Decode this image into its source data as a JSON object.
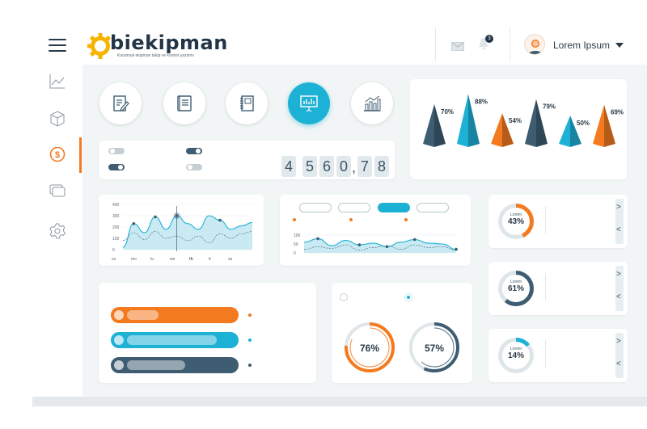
{
  "app": {
    "logo_text": "biekipman",
    "logo_subtitle": "Kurumsal ekipman takip ve kontrol yazılımı"
  },
  "header": {
    "notification_count": "3",
    "user_name": "Lorem Ipsum",
    "icons": [
      "menu-icon",
      "mail-icon",
      "bell-icon",
      "avatar-icon",
      "caret-down-icon"
    ]
  },
  "sidebar": {
    "items": [
      {
        "icon": "line-chart-icon",
        "active": false
      },
      {
        "icon": "cube-icon",
        "active": false
      },
      {
        "icon": "dollar-icon",
        "active": true
      },
      {
        "icon": "cards-icon",
        "active": false
      },
      {
        "icon": "settings-icon",
        "active": false
      }
    ]
  },
  "quick_actions": [
    {
      "icon": "edit-document-icon",
      "active": false
    },
    {
      "icon": "book-icon",
      "active": false
    },
    {
      "icon": "notebook-icon",
      "active": false
    },
    {
      "icon": "presentation-board-icon",
      "active": true
    },
    {
      "icon": "bar-chart-icon",
      "active": false
    }
  ],
  "counter": {
    "digits": [
      "4",
      "5",
      "6",
      "0",
      "7",
      "8"
    ],
    "separator": ",",
    "toggles": [
      {
        "on": false
      },
      {
        "on": true
      },
      {
        "on": true
      },
      {
        "on": false
      }
    ]
  },
  "pyramids": {
    "items": [
      {
        "label": "70%",
        "color": "#3f5d72",
        "value": 70
      },
      {
        "label": "88%",
        "color": "#1eb1d6",
        "value": 88
      },
      {
        "label": "54%",
        "color": "#f47a20",
        "value": 54
      },
      {
        "label": "79%",
        "color": "#3f5d72",
        "value": 79
      },
      {
        "label": "50%",
        "color": "#1eb1d6",
        "value": 50
      },
      {
        "label": "69%",
        "color": "#f47a20",
        "value": 69
      }
    ]
  },
  "chart_data": [
    {
      "type": "area",
      "categories": [
        "su",
        "mo",
        "tu",
        "we",
        "th",
        "fr",
        "sa"
      ],
      "highlight_category": "th",
      "ylim": [
        0,
        400
      ],
      "yticks": [
        "400",
        "300",
        "200",
        "100",
        "0"
      ],
      "series": [
        {
          "values": [
            20,
            230,
            150,
            290,
            180,
            300,
            230,
            180,
            300,
            260,
            180,
            210,
            240
          ],
          "color": "#1eb1d6"
        },
        {
          "values": [
            80,
            150,
            90,
            160,
            100,
            120,
            80,
            120,
            60,
            140,
            100,
            140,
            160
          ],
          "color": "#3f5d72"
        }
      ]
    },
    {
      "type": "area",
      "ylim": [
        0,
        100
      ],
      "yticks": [
        "100",
        "50",
        "0"
      ],
      "tabs": [
        {
          "on": false
        },
        {
          "on": false
        },
        {
          "on": true
        },
        {
          "on": false
        }
      ],
      "series": [
        {
          "values": [
            60,
            80,
            40,
            70,
            45,
            55,
            35,
            60,
            75,
            55,
            50,
            20
          ],
          "color": "#1eb1d6"
        },
        {
          "values": [
            20,
            35,
            25,
            45,
            15,
            30,
            40,
            20,
            45,
            30,
            35,
            15
          ],
          "color": "#3f5d72"
        }
      ]
    }
  ],
  "side_gauges": [
    {
      "label": "Lorem",
      "value": "43%",
      "percent": 43,
      "color": "#f47a20"
    },
    {
      "label": "Lorem",
      "value": "61%",
      "percent": 61,
      "color": "#3f5d72"
    },
    {
      "label": "Lorem",
      "value": "14%",
      "percent": 14,
      "color": "#1eb1d6"
    }
  ],
  "progress_bars": [
    {
      "color": "#f47a20",
      "fill": 0.3
    },
    {
      "color": "#1eb1d6",
      "fill": 0.85
    },
    {
      "color": "#3f5d72",
      "fill": 0.55
    }
  ],
  "big_gauges": [
    {
      "value": "76%",
      "percent": 76,
      "color": "#f47a20"
    },
    {
      "value": "57%",
      "percent": 57,
      "color": "#3f5d72"
    }
  ],
  "colors": {
    "accent": "#1eb1d6",
    "orange": "#f47a20",
    "navy": "#3f5d72",
    "background": "#f1f5f5"
  }
}
